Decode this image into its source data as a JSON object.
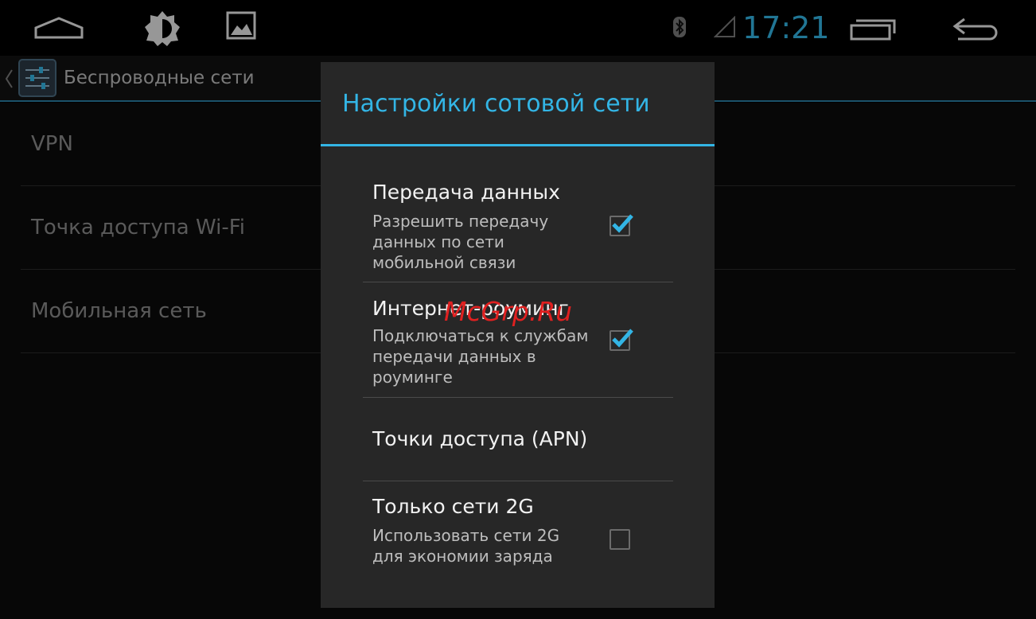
{
  "system_bar": {
    "clock": "17:21",
    "icons": [
      "home-icon",
      "brightness-icon",
      "gallery-icon",
      "bluetooth-icon",
      "signal-icon",
      "recent-apps-icon",
      "back-icon"
    ],
    "accent_color": "#33b5e5"
  },
  "action_bar": {
    "title": "Беспроводные сети",
    "icons": [
      "up-chevron-icon",
      "settings-app-icon"
    ]
  },
  "background_list": {
    "items": [
      {
        "label": "VPN"
      },
      {
        "label": "Точка доступа Wi-Fi"
      },
      {
        "label": "Мобильная сеть"
      }
    ]
  },
  "dialog": {
    "title": "Настройки сотовой сети",
    "prefs": [
      {
        "title": "Передача данных",
        "summary": "Разрешить передачу данных по сети мобильной связи",
        "checked": true
      },
      {
        "title": "Интернет-роуминг",
        "summary": "Подключаться к службам передачи данных в роуминге",
        "checked": true
      },
      {
        "title": "Точки доступа (APN)",
        "summary": ""
      },
      {
        "title": "Только сети 2G",
        "summary": "Использовать сети 2G для экономии заряда",
        "checked": false
      }
    ]
  },
  "watermark": "McGrp.Ru"
}
